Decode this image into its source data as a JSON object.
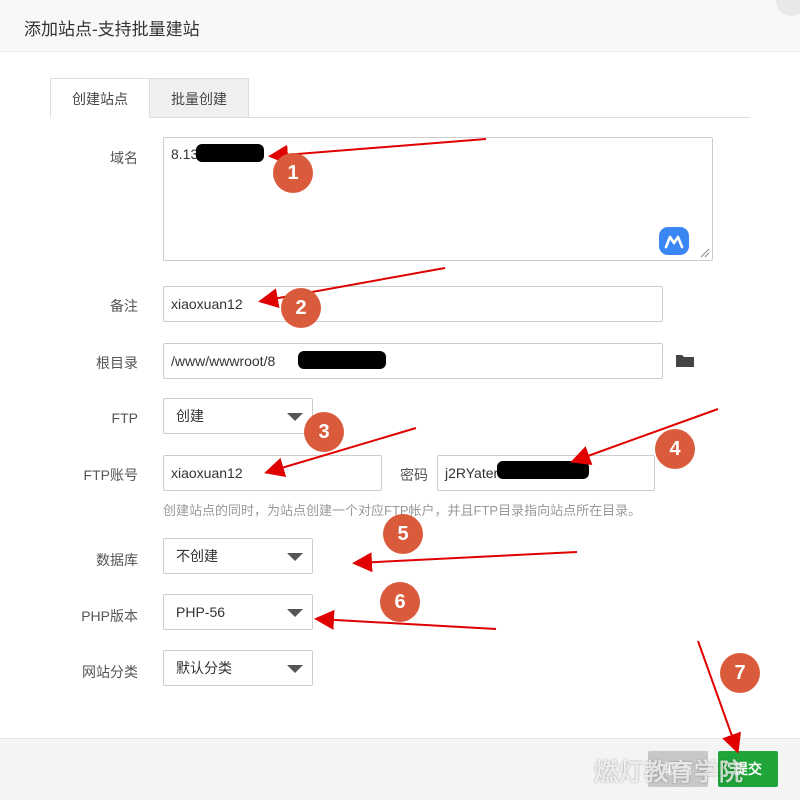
{
  "dialog": {
    "title": "添加站点-支持批量建站"
  },
  "tabs": [
    {
      "label": "创建站点",
      "active": true
    },
    {
      "label": "批量创建",
      "active": false
    }
  ],
  "form": {
    "domain": {
      "label": "域名",
      "value": "8.13"
    },
    "remark": {
      "label": "备注",
      "value": "xiaoxuan12"
    },
    "root": {
      "label": "根目录",
      "value": "/www/wwwroot/8"
    },
    "ftp": {
      "label": "FTP",
      "value": "创建"
    },
    "ftp_account": {
      "label": "FTP账号",
      "value": "xiaoxuan12",
      "password_label": "密码",
      "password_value": "j2RYater"
    },
    "ftp_hint": "创建站点的同时，为站点创建一个对应FTP帐户，并且FTP目录指向站点所在目录。",
    "database": {
      "label": "数据库",
      "value": "不创建"
    },
    "php": {
      "label": "PHP版本",
      "value": "PHP-56"
    },
    "category": {
      "label": "网站分类",
      "value": "默认分类"
    }
  },
  "footer": {
    "cancel_label": "取消",
    "submit_label": "提交"
  },
  "annotations": [
    "1",
    "2",
    "3",
    "4",
    "5",
    "6",
    "7"
  ],
  "watermark": "燃灯教育学院",
  "colors": {
    "accent_green": "#20a53a",
    "annotation_badge": "#d95b3c",
    "arrow_red": "#e00000"
  }
}
